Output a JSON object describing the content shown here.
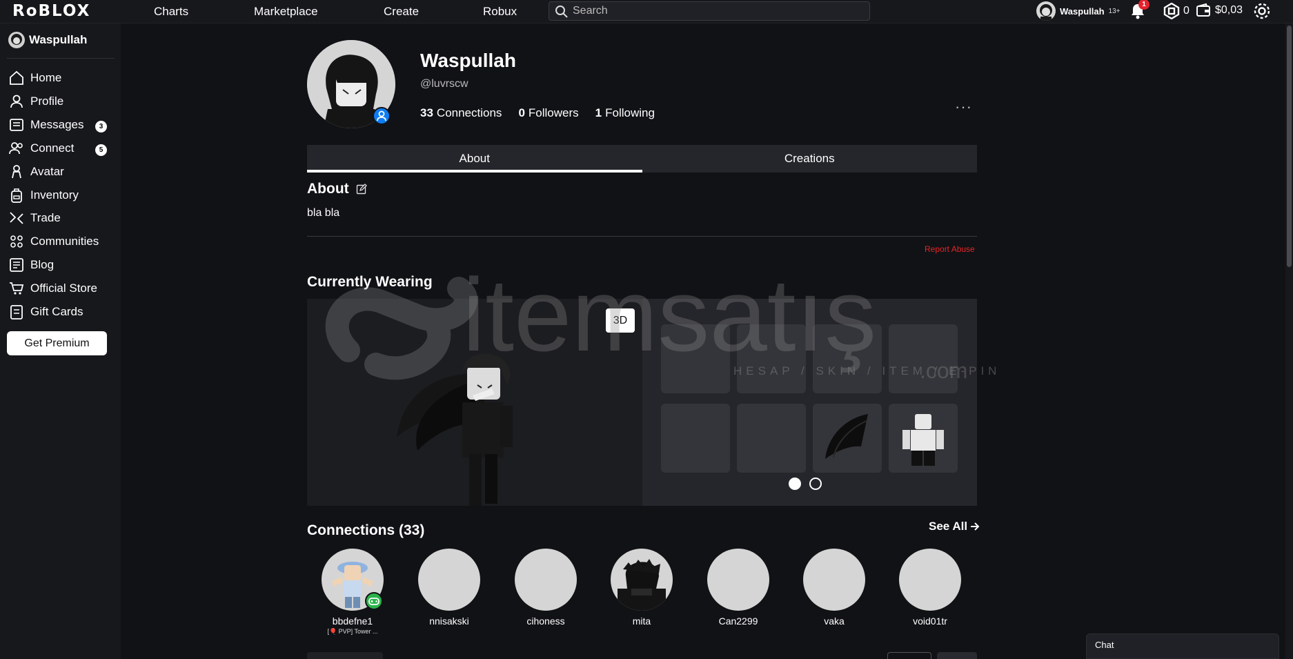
{
  "topbar": {
    "logo": "RᴏBLOX",
    "nav": [
      "Charts",
      "Marketplace",
      "Create",
      "Robux"
    ],
    "search_placeholder": "Search",
    "username": "Waspullah",
    "age_label": "13+",
    "notification_count": "1",
    "robux_balance": "0",
    "wallet_balance": "$0,03"
  },
  "sidebar": {
    "username": "Waspullah",
    "items": [
      {
        "label": "Home",
        "icon": "home-icon"
      },
      {
        "label": "Profile",
        "icon": "profile-icon"
      },
      {
        "label": "Messages",
        "icon": "messages-icon",
        "badge": "3"
      },
      {
        "label": "Connect",
        "icon": "connect-icon",
        "badge": "5"
      },
      {
        "label": "Avatar",
        "icon": "avatar-icon"
      },
      {
        "label": "Inventory",
        "icon": "inventory-icon"
      },
      {
        "label": "Trade",
        "icon": "trade-icon"
      },
      {
        "label": "Communities",
        "icon": "communities-icon"
      },
      {
        "label": "Blog",
        "icon": "blog-icon"
      },
      {
        "label": "Official Store",
        "icon": "store-icon"
      },
      {
        "label": "Gift Cards",
        "icon": "gift-card-icon"
      }
    ],
    "premium_label": "Get Premium"
  },
  "profile": {
    "display_name": "Waspullah",
    "handle": "@luvrscw",
    "connections_count": "33",
    "connections_label": "Connections",
    "followers_count": "0",
    "followers_label": "Followers",
    "following_count": "1",
    "following_label": "Following",
    "more": "···"
  },
  "tabs": [
    "About",
    "Creations"
  ],
  "about": {
    "heading": "About",
    "text": "bla bla",
    "report": "Report Abuse"
  },
  "wearing": {
    "heading": "Currently Wearing",
    "toggle_3d": "3D"
  },
  "watermark": {
    "brand": "itemsatış",
    "tagline": "HESAP / SKIN / ITEM / E-PIN",
    "tld": ".com"
  },
  "connections": {
    "heading": "Connections (33)",
    "see_all": "See All",
    "friends": [
      {
        "name": "bbdefne1",
        "sub": "[🎈 PVP] Tower ..."
      },
      {
        "name": "nnisakski"
      },
      {
        "name": "cihoness"
      },
      {
        "name": "mita"
      },
      {
        "name": "Can2299"
      },
      {
        "name": "vaka"
      },
      {
        "name": "void01tr"
      }
    ]
  },
  "chat": {
    "label": "Chat"
  },
  "colors": {
    "background": "#111216",
    "panel": "#17181c",
    "accent_blue": "#0f7cf2",
    "report_red": "#e32626",
    "badge_red": "#e3232d",
    "online_green": "#2bb34b"
  }
}
